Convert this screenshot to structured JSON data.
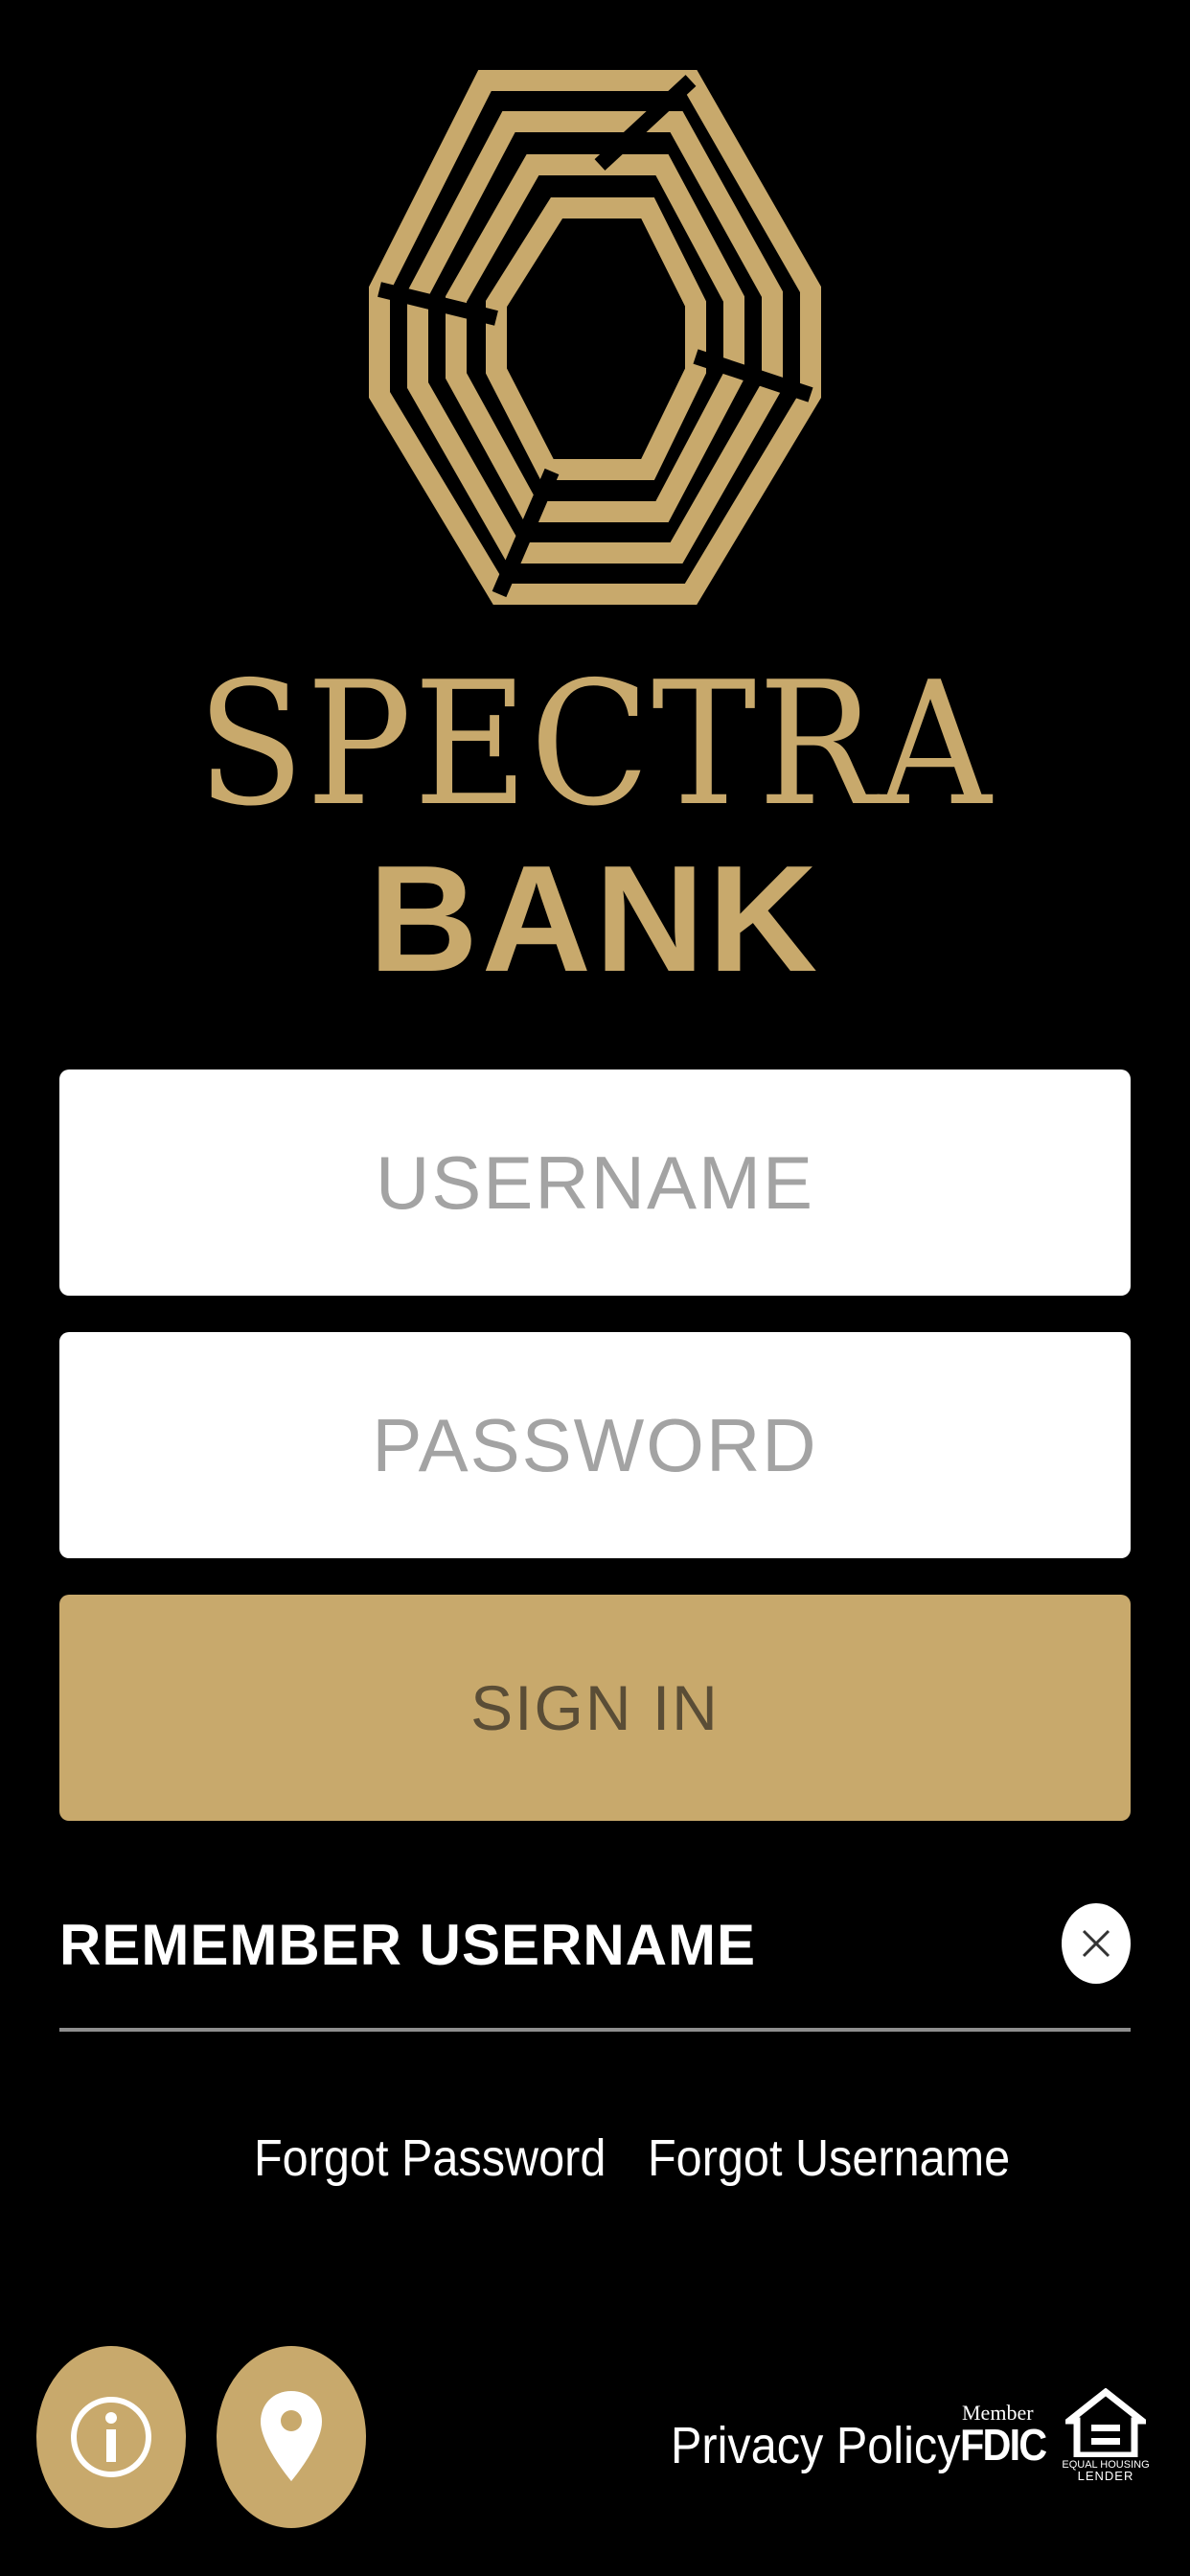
{
  "brand": {
    "name_line1": "SPECTRA",
    "name_line2": "BANK",
    "logo_icon": "spectra-hexagon-logo",
    "gold_color": "#C8A96C"
  },
  "login": {
    "username_placeholder": "USERNAME",
    "password_placeholder": "PASSWORD",
    "sign_in_label": "SIGN IN",
    "remember_username_label": "REMEMBER USERNAME",
    "remember_username_enabled": false,
    "remember_toggle_icon": "close-icon"
  },
  "links": {
    "forgot_password": "Forgot Password",
    "forgot_username": "Forgot Username"
  },
  "footer": {
    "info_icon": "info-icon",
    "location_icon": "location-pin-icon",
    "privacy_policy": "Privacy Policy",
    "fdic_member": "Member",
    "fdic_mark": "FDIC",
    "equal_housing_line1": "EQUAL HOUSING",
    "equal_housing_line2": "LENDER"
  }
}
